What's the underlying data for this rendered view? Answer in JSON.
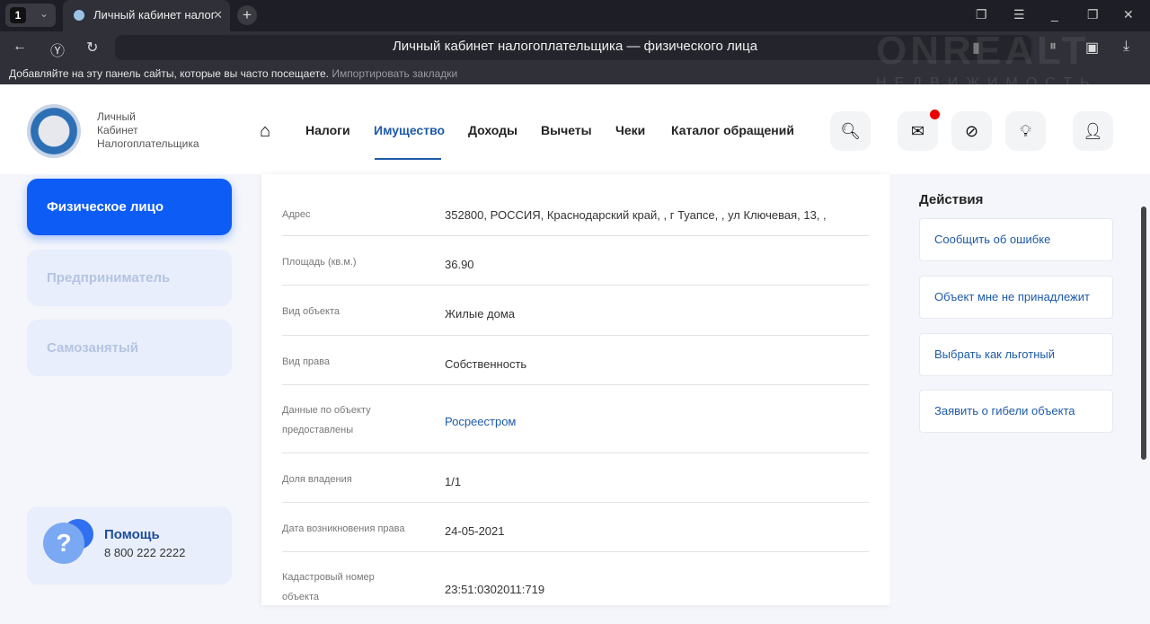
{
  "browser": {
    "tab_count": "1",
    "tab_title": "Личный кабинет налог",
    "page_title": "Личный кабинет налогоплательщика — физического лица",
    "bookmarks_hint": "Добавляйте на эту панель сайты, которые вы часто посещаете.",
    "import_bookmarks": "Импортировать закладки",
    "watermark": "ONREALT",
    "watermark_sub": "НЕДВИЖИМОСТЬ"
  },
  "header": {
    "logo_text": [
      "Личный",
      "Кабинет",
      "Налогоплательщика"
    ],
    "menu": [
      "Налоги",
      "Имущество",
      "Доходы",
      "Вычеты",
      "Чеки",
      "Каталог обращений"
    ],
    "active": "Имущество"
  },
  "sidebar": {
    "items": [
      "Физическое лицо",
      "Предприниматель",
      "Самозанятый"
    ],
    "help_title": "Помощь",
    "help_phone": "8 800 222 2222"
  },
  "details": [
    {
      "label": "Адрес",
      "value": "352800, РОССИЯ, Краснодарский край, , г Туапсе, , ул Ключевая, 13, ,"
    },
    {
      "label": "Площадь (кв.м.)",
      "value": "36.90"
    },
    {
      "label": "Вид объекта",
      "value": "Жилые дома"
    },
    {
      "label": "Вид права",
      "value": "Собственность"
    },
    {
      "label": "Данные по объекту предоставлены",
      "value": "Росреестром"
    },
    {
      "label": "Доля владения",
      "value": "1/1"
    },
    {
      "label": "Дата возникновения права",
      "value": "24-05-2021"
    },
    {
      "label": "Кадастровый номер объекта",
      "value": "23:51:0302011:719"
    }
  ],
  "actions": {
    "title": "Действия",
    "items": [
      "Сообщить об ошибке",
      "Объект мне не принадлежит",
      "Выбрать как льготный",
      "Заявить о гибели объекта"
    ]
  }
}
